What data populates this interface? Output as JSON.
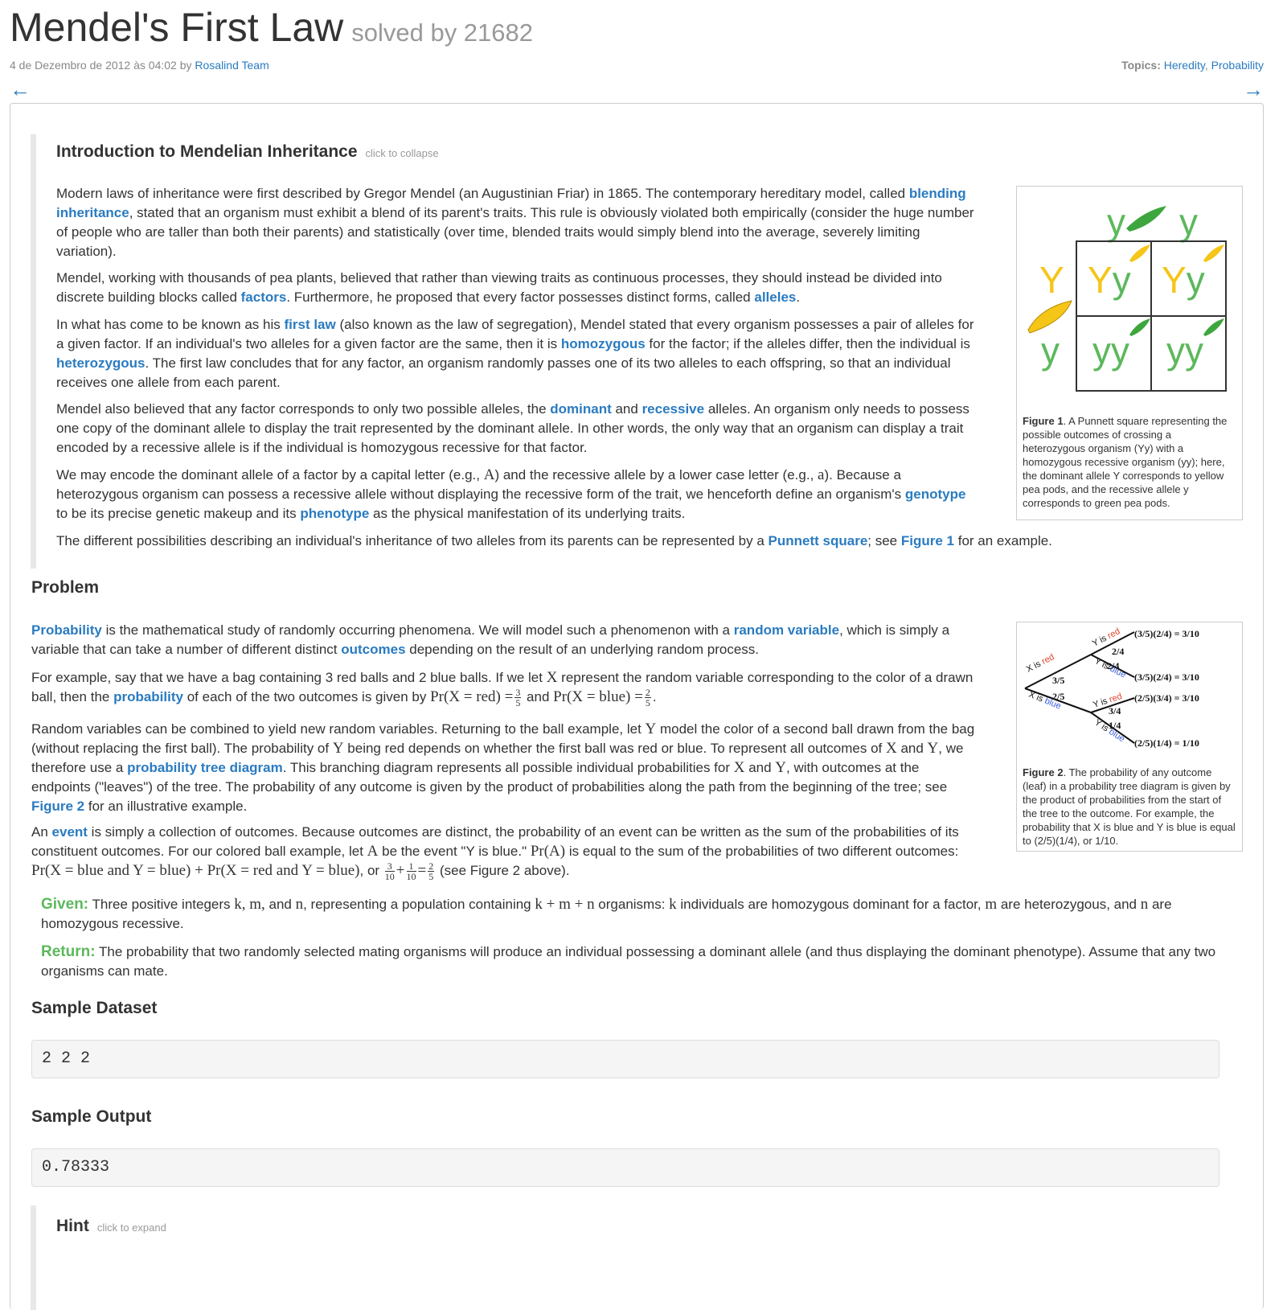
{
  "header": {
    "title": "Mendel's First Law",
    "solved": "solved by 21682",
    "date": "4 de Dezembro de 2012 às 04:02",
    "by": " by ",
    "author": "Rosalind Team",
    "topics_label": "Topics:",
    "topic_1": "Heredity",
    "topic_sep": ", ",
    "topic_2": "Probability",
    "prev_arrow": "←",
    "next_arrow": "→"
  },
  "intro": {
    "title": "Introduction to Mendelian Inheritance",
    "collapse": "click to collapse",
    "p1": [
      "Modern laws of inheritance were first described by Gregor Mendel (an Augustinian Friar) in 1865. The contemporary hereditary model, called ",
      "blending inheritance",
      ", stated that an organism must exhibit a blend of its parent's traits. This rule is obviously violated both empirically (consider the huge number of people who are taller than both their parents) and statistically (over time, blended traits would simply blend into the average, severely limiting variation)."
    ],
    "p2": [
      "Mendel, working with thousands of pea plants, believed that rather than viewing traits as continuous processes, they should instead be divided into discrete building blocks called ",
      "factors",
      ". Furthermore, he proposed that every factor possesses distinct forms, called ",
      "alleles",
      "."
    ],
    "p3": [
      "In what has come to be known as his ",
      "first law",
      " (also known as the law of segregation), Mendel stated that every organism possesses a pair of alleles for a given factor. If an individual's two alleles for a given factor are the same, then it is ",
      "homozygous",
      " for the factor; if the alleles differ, then the individual is ",
      "heterozygous",
      ". The first law concludes that for any factor, an organism randomly passes one of its two alleles to each offspring, so that an individual receives one allele from each parent."
    ],
    "p4": [
      "Mendel also believed that any factor corresponds to only two possible alleles, the ",
      "dominant",
      " and ",
      "recessive",
      " alleles. An organism only needs to possess one copy of the dominant allele to display the trait represented by the dominant allele. In other words, the only way that an organism can display a trait encoded by a recessive allele is if the individual is homozygous recessive for that factor."
    ],
    "p5": [
      "We may encode the dominant allele of a factor by a capital letter (e.g., ",
      "A",
      ") and the recessive allele by a lower case letter (e.g., ",
      "a",
      "). Because a heterozygous organism can possess a recessive allele without displaying the recessive form of the trait, we henceforth define an organism's ",
      "genotype",
      " to be its precise genetic makeup and its ",
      "phenotype",
      " as the physical manifestation of its underlying traits."
    ],
    "p6": [
      "The different possibilities describing an individual's inheritance of two alleles from its parents can be represented by a ",
      "Punnett square",
      "; see ",
      "Figure 1",
      " for an example."
    ]
  },
  "figure1": {
    "col_1": "y",
    "col_2": "y",
    "row_1": "Y",
    "row_2": "y",
    "cell_11": "Yy",
    "cell_12": "Yy",
    "cell_21": "yy",
    "cell_22": "yy",
    "cap_label": "Figure 1",
    "caption": ". A Punnett square representing the possible outcomes of crossing a heterozygous organism (Yy) with a homozygous recessive organism (yy); here, the dominant allele Y corresponds to yellow pea pods, and the recessive allele y corresponds to green pea pods.",
    "colors": {
      "yellow": "#f5c518",
      "green": "#5cb85c"
    }
  },
  "problem": {
    "title": "Problem",
    "p1": [
      "Probability",
      " is the mathematical study of randomly occurring phenomena. We will model such a phenomenon with a ",
      "random variable",
      ", which is simply a variable that can take a number of different distinct ",
      "outcomes",
      " depending on the result of an underlying random process."
    ],
    "p2": [
      "For example, say that we have a bag containing 3 red balls and 2 blue balls. If we let ",
      "X",
      " represent the random variable corresponding to the color of a drawn ball, then the ",
      "probability",
      " of each of the two outcomes is given by ",
      "Pr(X = red) =",
      "3",
      "5",
      " and ",
      "Pr(X = blue) =",
      "2",
      "5",
      "."
    ],
    "p3": [
      "Random variables can be combined to yield new random variables. Returning to the ball example, let ",
      "Y",
      " model the color of a second ball drawn from the bag (without replacing the first ball). The probability of ",
      "Y",
      " being red depends on whether the first ball was red or blue. To represent all outcomes of ",
      "X",
      " and ",
      "Y",
      ", we therefore use a ",
      "probability tree diagram",
      ". This branching diagram represents all possible individual probabilities for ",
      "X",
      " and ",
      "Y",
      ", with outcomes at the endpoints (\"leaves\") of the tree. The probability of any outcome is given by the product of probabilities along the path from the beginning of the tree; see ",
      "Figure 2",
      " for an illustrative example."
    ],
    "p4": [
      "An ",
      "event",
      " is simply a collection of outcomes. Because outcomes are distinct, the probability of an event can be written as the sum of the probabilities of its constituent outcomes. For our colored ball example, let ",
      "A",
      " be the event \"Y is blue.\" ",
      "Pr(A)",
      " is equal to the sum of the probabilities of two different outcomes: ",
      "Pr(X = blue and Y = blue) + Pr(X = red and Y = blue)",
      ", or ",
      "3",
      "10",
      "+",
      "1",
      "10",
      "=",
      "2",
      "5",
      " (see Figure 2 above)."
    ],
    "given_label": "Given:",
    "given": [
      " Three positive integers ",
      "k, m,",
      " and ",
      "n",
      ", representing a population containing ",
      "k + m + n",
      " organisms: ",
      "k",
      " individuals are homozygous dominant for a factor, ",
      "m",
      " are heterozygous, and ",
      "n",
      " are homozygous recessive."
    ],
    "return_label": "Return:",
    "return": " The probability that two randomly selected mating organisms will produce an individual possessing a dominant allele (and thus displaying the dominant phenotype). Assume that any two organisms can mate."
  },
  "figure2": {
    "x_red": "X is red",
    "x_blue": "X is blue",
    "y_red": "Y is red",
    "y_blue": "Y is blue",
    "p_x_red": "3/5",
    "p_x_blue": "2/5",
    "p_1": "2/4",
    "p_2": "2/4",
    "p_3": "3/4",
    "p_4": "1/4",
    "leaf_1": "(3/5)(2/4) = 3/10",
    "leaf_2": "(3/5)(2/4) = 3/10",
    "leaf_3": "(2/5)(3/4) = 3/10",
    "leaf_4": "(2/5)(1/4) = 1/10",
    "cap_label": "Figure 2",
    "caption": ". The probability of any outcome (leaf) in a probability tree diagram is given by the product of probabilities from the start of the tree to the outcome. For example, the probability that X is blue and Y is blue is equal to (2/5)(1/4), or 1/10.",
    "colors": {
      "red": "#e0452f",
      "blue": "#3a5fd9"
    }
  },
  "sample": {
    "dataset_title": "Sample Dataset",
    "dataset": "2 2 2",
    "output_title": "Sample Output",
    "output": "0.78333"
  },
  "hint": {
    "title": "Hint",
    "expand": "click to expand"
  }
}
